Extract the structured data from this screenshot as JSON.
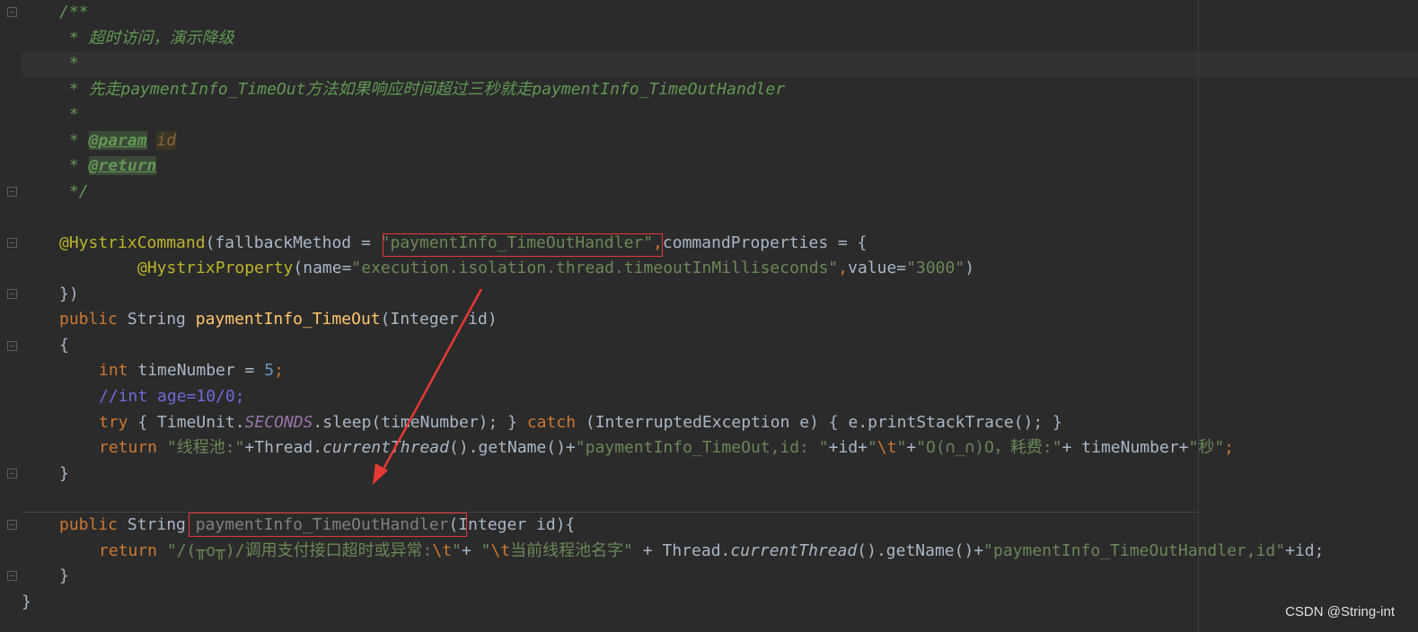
{
  "code": {
    "l1": "/**",
    "l2": " * 超时访问，演示降级",
    "l3": " *",
    "l4": " * 先走paymentInfo_TimeOut方法如果响应时间超过三秒就走paymentInfo_TimeOutHandler",
    "l5": " *",
    "l6_star": " * ",
    "l6_tag": "@param",
    "l6_param": "id",
    "l7_star": " * ",
    "l7_tag": "@return",
    "l8": " */",
    "l9_ann": "@HystrixCommand",
    "l9_a": "(fallbackMethod = ",
    "l9_str": "\"paymentInfo_TimeOutHandler\"",
    "l9_comma": ",",
    "l9_b": "commandProperties = {",
    "l10_ann": "@HystrixProperty",
    "l10_a": "(name=",
    "l10_str1": "\"execution.isolation.thread.timeoutInMilliseconds\"",
    "l10_comma": ",",
    "l10_b": "value=",
    "l10_str2": "\"3000\"",
    "l10_c": ")",
    "l11": "})",
    "l12_kw": "public",
    "l12_a": " String ",
    "l12_fn": "paymentInfo_TimeOut",
    "l12_b": "(Integer id)",
    "l13": "{",
    "l14_kw": "int",
    "l14_a": " timeNumber = ",
    "l14_num": "5",
    "l14_semi": ";",
    "l15": "//int age=10/0;",
    "l16_try": "try",
    "l16_a": " { TimeUnit.",
    "l16_const": "SECONDS",
    "l16_b": ".sleep(timeNumber); } ",
    "l16_catch": "catch",
    "l16_c": " (InterruptedException e) { e.printStackTrace(); }",
    "l17_kw": "return",
    "l17_s1": " \"线程池:\"",
    "l17_a": "+Thread.",
    "l17_it": "currentThread",
    "l17_b": "().getName()+",
    "l17_s2": "\"paymentInfo_TimeOut,id: \"",
    "l17_c": "+id+",
    "l17_q1": "\"",
    "l17_esc": "\\t",
    "l17_q2": "\"",
    "l17_d": "+",
    "l17_s3": "\"O(∩_∩)O，耗费:\"",
    "l17_e": "+ timeNumber+",
    "l17_s4": "\"秒\"",
    "l17_semi": ";",
    "l18": "}",
    "l19_kw": "public",
    "l19_a": " String ",
    "l19_fn": "paymentInfo_TimeOutHandler",
    "l19_b": "(Integer id){",
    "l20_kw": "return",
    "l20_s1a": " \"/(╥o╥)/调用支付接口超时或异常:",
    "l20_esc1": "\\t",
    "l20_s1b": "\"",
    "l20_a": "+ ",
    "l20_s2a": "\"",
    "l20_esc2": "\\t",
    "l20_s2b": "当前线程池名字\"",
    "l20_b": " + Thread.",
    "l20_it": "currentThread",
    "l20_c": "().getName()+",
    "l20_s3": "\"paymentInfo_TimeOutHandler,id\"",
    "l20_d": "+id;",
    "l21": "}",
    "l22": "}"
  },
  "watermark": "CSDN @String-int",
  "colors": {
    "background": "#2b2b2b",
    "annotation_box": "#e53935",
    "arrow": "#e53935"
  }
}
